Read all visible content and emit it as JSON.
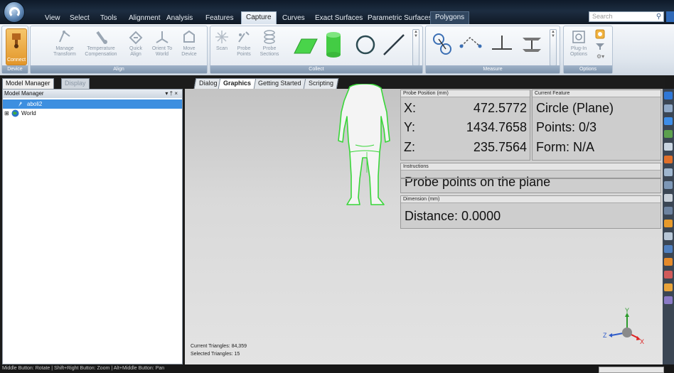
{
  "ribbon_tabs": [
    "View",
    "Select",
    "Tools",
    "Alignment",
    "Analysis",
    "Features",
    "Capture",
    "Curves",
    "Exact Surfaces",
    "Parametric Surfaces",
    "Polygons"
  ],
  "active_tab": "Capture",
  "search": {
    "placeholder": "Search"
  },
  "groups": {
    "device": {
      "caption": "Device",
      "connect_label": "Connect"
    },
    "align": {
      "caption": "Align",
      "buttons": [
        {
          "line1": "Manage",
          "line2": "Transform"
        },
        {
          "line1": "Temperature",
          "line2": "Compensation"
        },
        {
          "line1": "Quick",
          "line2": "Align"
        },
        {
          "line1": "Orient To",
          "line2": "World"
        },
        {
          "line1": "Move",
          "line2": "Device"
        }
      ]
    },
    "collect": {
      "caption": "Collect",
      "buttons": [
        {
          "line1": "Scan",
          "line2": ""
        },
        {
          "line1": "Probe",
          "line2": "Points"
        },
        {
          "line1": "Probe",
          "line2": "Sections"
        }
      ]
    },
    "measure": {
      "caption": "Measure"
    },
    "options": {
      "caption": "Options",
      "plugin_line1": "Plug-In",
      "plugin_line2": "Options"
    }
  },
  "left_panel": {
    "tabs": [
      "Model Manager",
      "Display"
    ],
    "title": "Model Manager",
    "controls": "▾ † ×",
    "items": [
      {
        "label": "aboli2",
        "selected": true
      },
      {
        "label": "World",
        "selected": false
      }
    ]
  },
  "viewport_tabs": [
    "Dialog",
    "Graphics",
    "Getting Started",
    "Scripting"
  ],
  "active_viewport_tab": "Graphics",
  "probe": {
    "title": "Probe Position (mm)",
    "x_label": "X:",
    "x": "472.5772",
    "y_label": "Y:",
    "y": "1434.7658",
    "z_label": "Z:",
    "z": "235.7564"
  },
  "feature": {
    "title": "Current Feature",
    "name": "Circle (Plane)",
    "points": "Points: 0/3",
    "form": "Form: N/A"
  },
  "instructions": {
    "title": "Instructions",
    "text": "Probe points on the plane"
  },
  "dimension": {
    "title": "Dimension (mm)",
    "text": "Distance: 0.0000"
  },
  "viewport_status": {
    "current": "Current Triangles: 84,359",
    "selected": "Selected Triangles: 15"
  },
  "axes": {
    "x": "X",
    "y": "Y",
    "z": "Z"
  },
  "status_bar": "Middle Button: Rotate | Shift+Right Button: Zoom | Alt+Middle Button: Pan",
  "colors": {
    "accent": "#3d8fe0",
    "model_outline": "#39d639",
    "connect": "#e8a33a"
  }
}
